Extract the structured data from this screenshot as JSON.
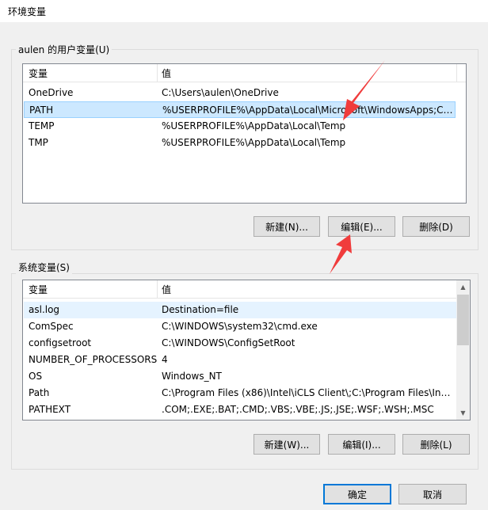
{
  "window": {
    "title": "环境变量"
  },
  "user_vars": {
    "group_label": "aulen 的用户变量(U)",
    "columns": [
      "变量",
      "值"
    ],
    "rows": [
      {
        "name": "OneDrive",
        "value": "C:\\Users\\aulen\\OneDrive"
      },
      {
        "name": "PATH",
        "value": "%USERPROFILE%\\AppData\\Local\\Microsoft\\WindowsApps;C:..."
      },
      {
        "name": "TEMP",
        "value": "%USERPROFILE%\\AppData\\Local\\Temp"
      },
      {
        "name": "TMP",
        "value": "%USERPROFILE%\\AppData\\Local\\Temp"
      }
    ],
    "selected_row": "PATH",
    "buttons": {
      "new": "新建(N)...",
      "edit": "编辑(E)...",
      "delete": "删除(D)"
    }
  },
  "system_vars": {
    "group_label": "系统变量(S)",
    "columns": [
      "变量",
      "值"
    ],
    "rows": [
      {
        "name": "asl.log",
        "value": "Destination=file"
      },
      {
        "name": "ComSpec",
        "value": "C:\\WINDOWS\\system32\\cmd.exe"
      },
      {
        "name": "configsetroot",
        "value": "C:\\WINDOWS\\ConfigSetRoot"
      },
      {
        "name": "NUMBER_OF_PROCESSORS",
        "value": "4"
      },
      {
        "name": "OS",
        "value": "Windows_NT"
      },
      {
        "name": "Path",
        "value": "C:\\Program Files (x86)\\Intel\\iCLS Client\\;C:\\Program Files\\Intel..."
      },
      {
        "name": "PATHEXT",
        "value": ".COM;.EXE;.BAT;.CMD;.VBS;.VBE;.JS;.JSE;.WSF;.WSH;.MSC"
      }
    ],
    "buttons": {
      "new": "新建(W)...",
      "edit": "编辑(I)...",
      "delete": "删除(L)"
    }
  },
  "dialog_buttons": {
    "ok": "确定",
    "cancel": "取消"
  },
  "colors": {
    "annotation_arrow": "#f03c3c",
    "selection": "#cce8ff",
    "default_button_border": "#0078d7"
  }
}
